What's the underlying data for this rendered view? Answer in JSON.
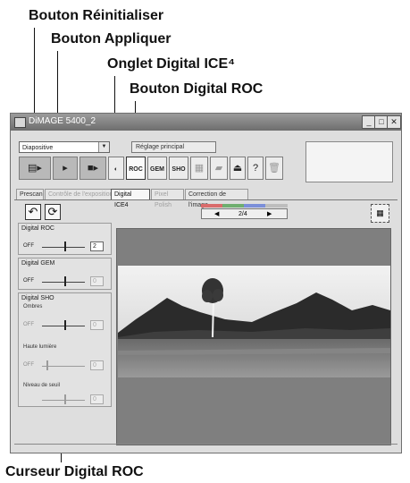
{
  "callouts": {
    "reset": "Bouton Réinitialiser",
    "apply": "Bouton Appliquer",
    "ice_tab": "Onglet Digital ICE⁴",
    "roc_button": "Bouton Digital ROC",
    "roc_slider": "Curseur Digital ROC"
  },
  "window": {
    "title": "DiMAGE 5400_2",
    "film_type": "Diapositive",
    "main_setting_button": "Réglage principal",
    "toolbar": {
      "roc": "ROC",
      "gem": "GEM",
      "sho": "SHO",
      "eject": "⏏",
      "help": "?"
    }
  },
  "tabs": [
    {
      "label": "Prescan"
    },
    {
      "label": "Contrôle de l'exposition"
    },
    {
      "label": "Digital ICE4"
    },
    {
      "label": "Pixel Polish"
    },
    {
      "label": "Correction de l'image"
    }
  ],
  "navigator": {
    "page": "2/4",
    "colors": [
      "#d96b6b",
      "#6fae6f",
      "#7b8fd9",
      "#bdbdbd"
    ]
  },
  "panels": {
    "roc": {
      "title": "Digital ROC",
      "off": "OFF",
      "value": "2"
    },
    "gem": {
      "title": "Digital GEM",
      "off": "OFF",
      "value": "0"
    },
    "sho": {
      "title": "Digital SHO",
      "shadows": "Ombres",
      "highlights": "Haute lumière",
      "threshold": "Niveau de seuil",
      "off1": "OFF",
      "off2": "OFF",
      "shadows_value": "0",
      "highlights_value": "0",
      "threshold_value": "0"
    }
  }
}
